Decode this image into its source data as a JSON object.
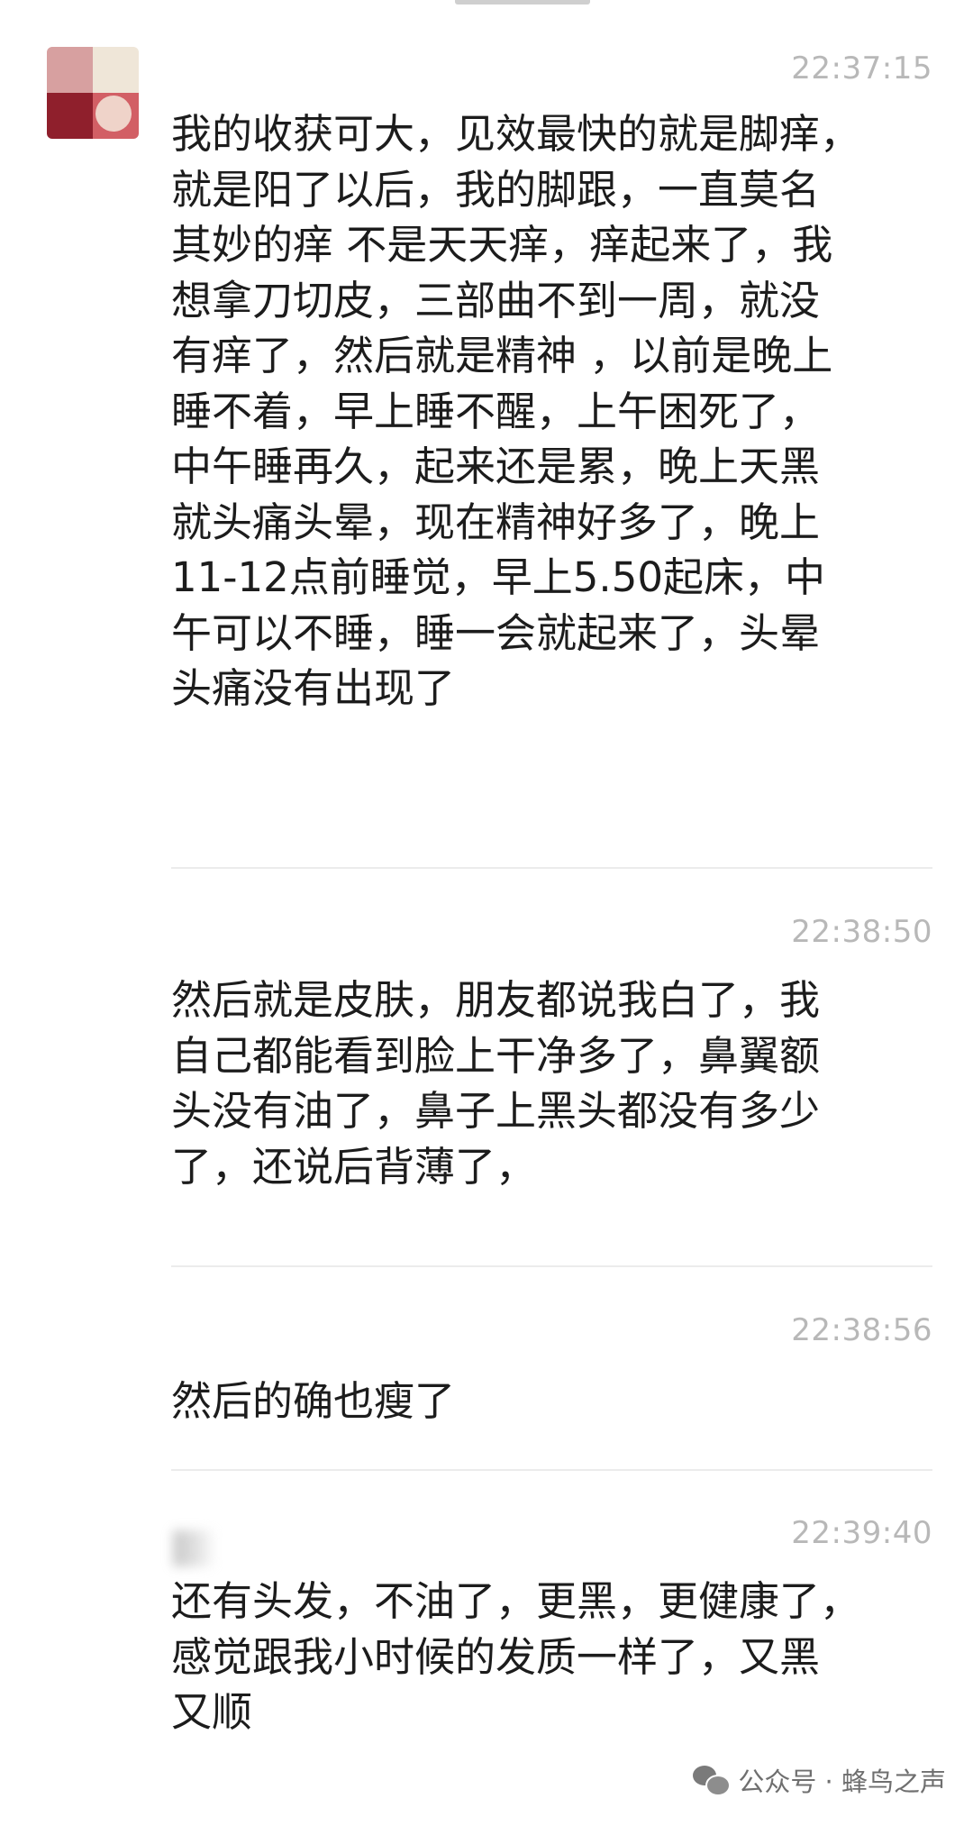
{
  "messages": [
    {
      "time": "22:37:15",
      "text": "我的收获可大，见效最快的就是脚痒，\n就是阳了以后，我的脚跟，一直莫名\n其妙的痒 不是天天痒，痒起来了，我\n想拿刀切皮，三部曲不到一周，就没\n有痒了，然后就是精神 ，以前是晚上\n睡不着，早上睡不醒，上午困死了，\n中午睡再久，起来还是累，晚上天黑\n就头痛头晕，现在精神好多了，晚上\n11-12点前睡觉，早上5.50起床，中\n午可以不睡，睡一会就起来了，头晕\n头痛没有出现了"
    },
    {
      "time": "22:38:50",
      "text": "然后就是皮肤，朋友都说我白了，我\n自己都能看到脸上干净多了，鼻翼额\n头没有油了，鼻子上黑头都没有多少\n了，还说后背薄了，"
    },
    {
      "time": "22:38:56",
      "text": "然后的确也瘦了"
    },
    {
      "time": "22:39:40",
      "text": "还有头发，不油了，更黑，更健康了，\n感觉跟我小时候的发质一样了，又黑\n又顺"
    }
  ],
  "watermark": {
    "label": "公众号 · 蜂鸟之声",
    "icon": "wechat-icon"
  }
}
